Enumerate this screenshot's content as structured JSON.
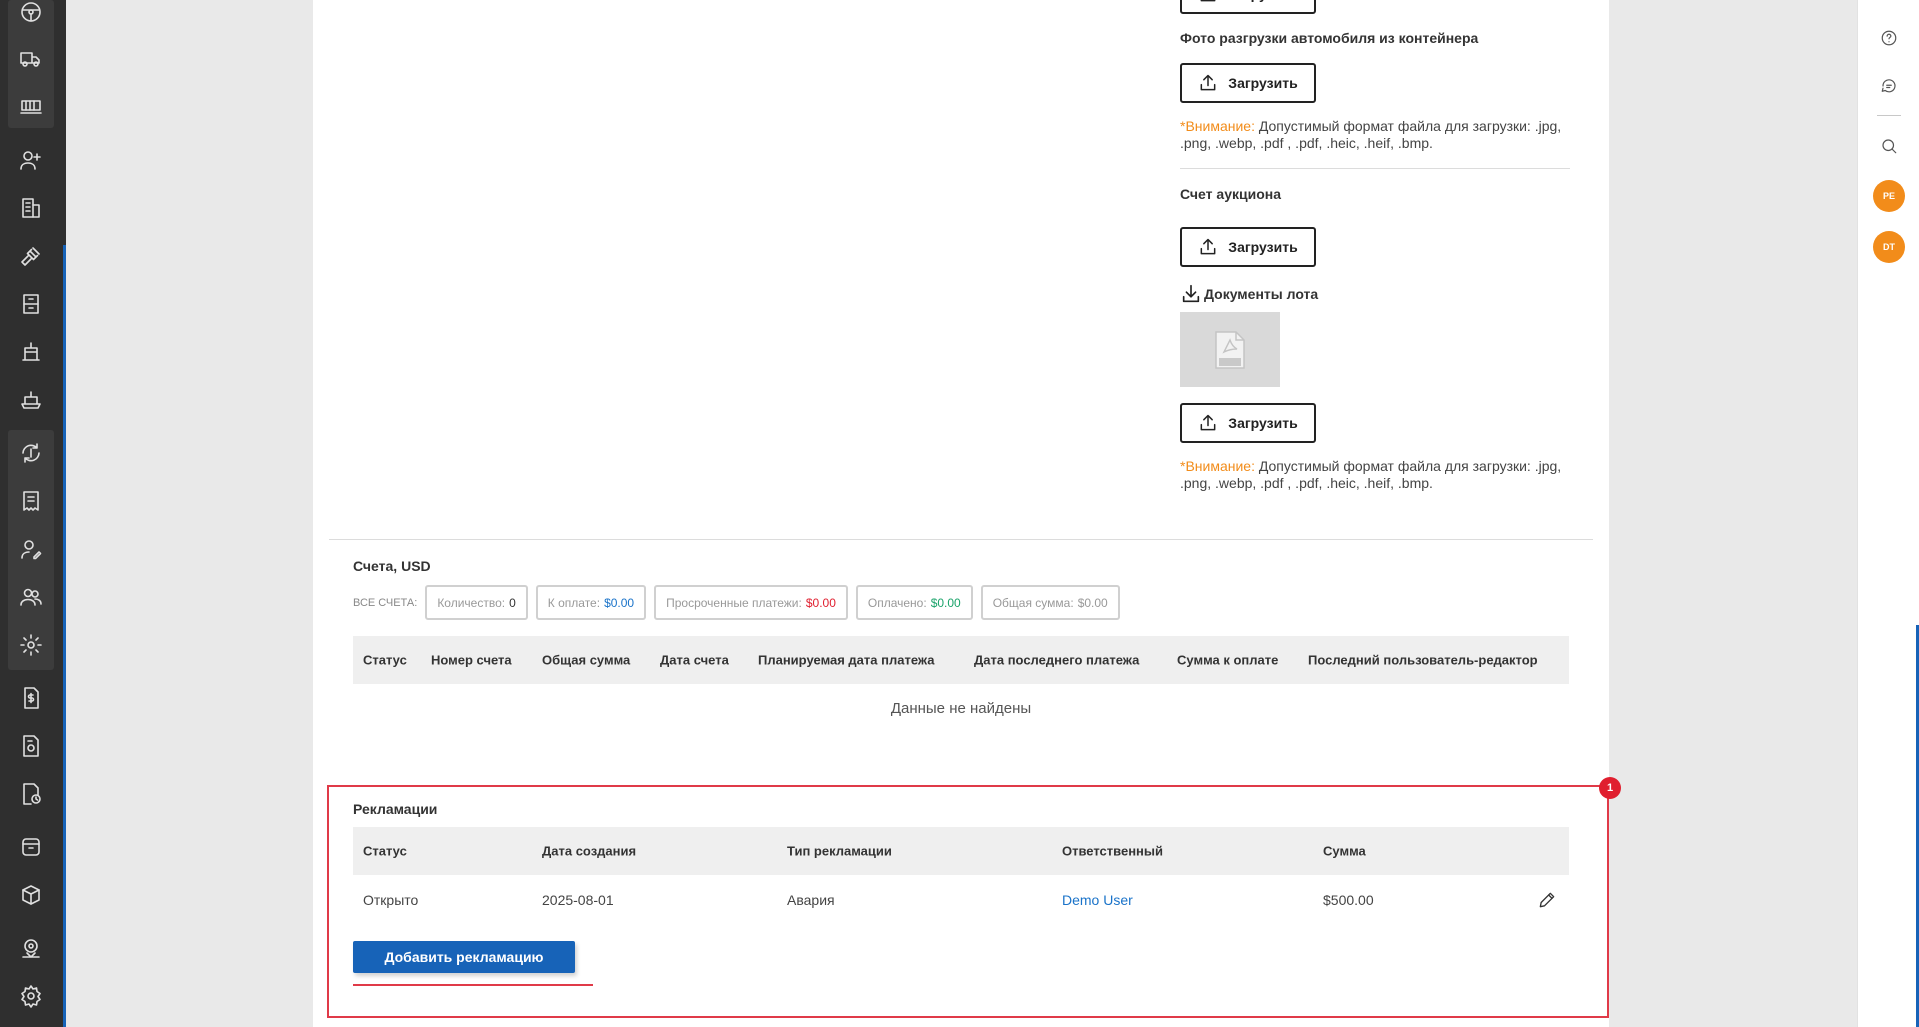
{
  "sidebar": {
    "items": [
      {
        "icon": "steering-wheel-icon"
      },
      {
        "icon": "truck-icon"
      },
      {
        "icon": "railcar-icon"
      },
      {
        "icon": "user-add-icon"
      },
      {
        "icon": "building-icon"
      },
      {
        "icon": "gavel-icon"
      },
      {
        "icon": "warehouse-box-icon"
      },
      {
        "icon": "crane-icon"
      },
      {
        "icon": "ship-icon"
      },
      {
        "icon": "currency-exchange-icon"
      },
      {
        "icon": "receipt-icon"
      },
      {
        "icon": "user-edit-icon"
      },
      {
        "icon": "users-icon"
      },
      {
        "icon": "settings-cog-user-icon"
      },
      {
        "icon": "document-dollar-icon"
      },
      {
        "icon": "document-settings-icon"
      },
      {
        "icon": "document-clock-icon"
      },
      {
        "icon": "archive-icon"
      },
      {
        "icon": "package-sync-icon"
      },
      {
        "icon": "map-pin-icon"
      },
      {
        "icon": "gear-icon"
      }
    ]
  },
  "rightrail": {
    "help_icon": "help-icon",
    "chat_icon": "chat-icon",
    "search_icon": "search-icon",
    "avatars": [
      "PE",
      "DT"
    ]
  },
  "uploads": {
    "unloading_photo_title": "Фото разгрузки автомобиля из контейнера",
    "upload_label": "Загрузить",
    "warning_prefix": "*Внимание:",
    "warning_text": " Допустимый формат файла для загрузки: .jpg, .png, .webp, .pdf , .pdf, .heic, .heif, .bmp.",
    "auction_invoice_title": "Счет аукциона",
    "lot_documents_title": "Документы лота"
  },
  "invoices": {
    "title": "Счета, USD",
    "all_label": "ВСЕ СЧЕТА:",
    "chips": [
      {
        "label": "Количество:",
        "value": "0",
        "color": "#333333"
      },
      {
        "label": "К оплате:",
        "value": "$0.00",
        "color": "#1a73c9"
      },
      {
        "label": "Просроченные платежи:",
        "value": "$0.00",
        "color": "#e01f2f"
      },
      {
        "label": "Оплачено:",
        "value": "$0.00",
        "color": "#1aa36a"
      },
      {
        "label": "Общая сумма:",
        "value": "$0.00",
        "color": "#999999"
      }
    ],
    "columns": [
      "Статус",
      "Номер счета",
      "Общая сумма",
      "Дата счета",
      "Планируемая дата платежа",
      "Дата последнего платежа",
      "Сумма к оплате",
      "Последний пользователь-редактор"
    ],
    "empty_text": "Данные не найдены"
  },
  "claims": {
    "title": "Рекламации",
    "badge": "1",
    "columns": [
      "Статус",
      "Дата создания",
      "Тип рекламации",
      "Ответственный",
      "Сумма"
    ],
    "rows": [
      {
        "status": "Открыто",
        "created": "2025-08-01",
        "type": "Авария",
        "responsible": "Demo User",
        "amount": "$500.00"
      }
    ],
    "add_label": "Добавить рекламацию"
  },
  "colors": {
    "accent": "#1763b8",
    "warning": "#f28c1a",
    "highlight": "#e03a48"
  }
}
